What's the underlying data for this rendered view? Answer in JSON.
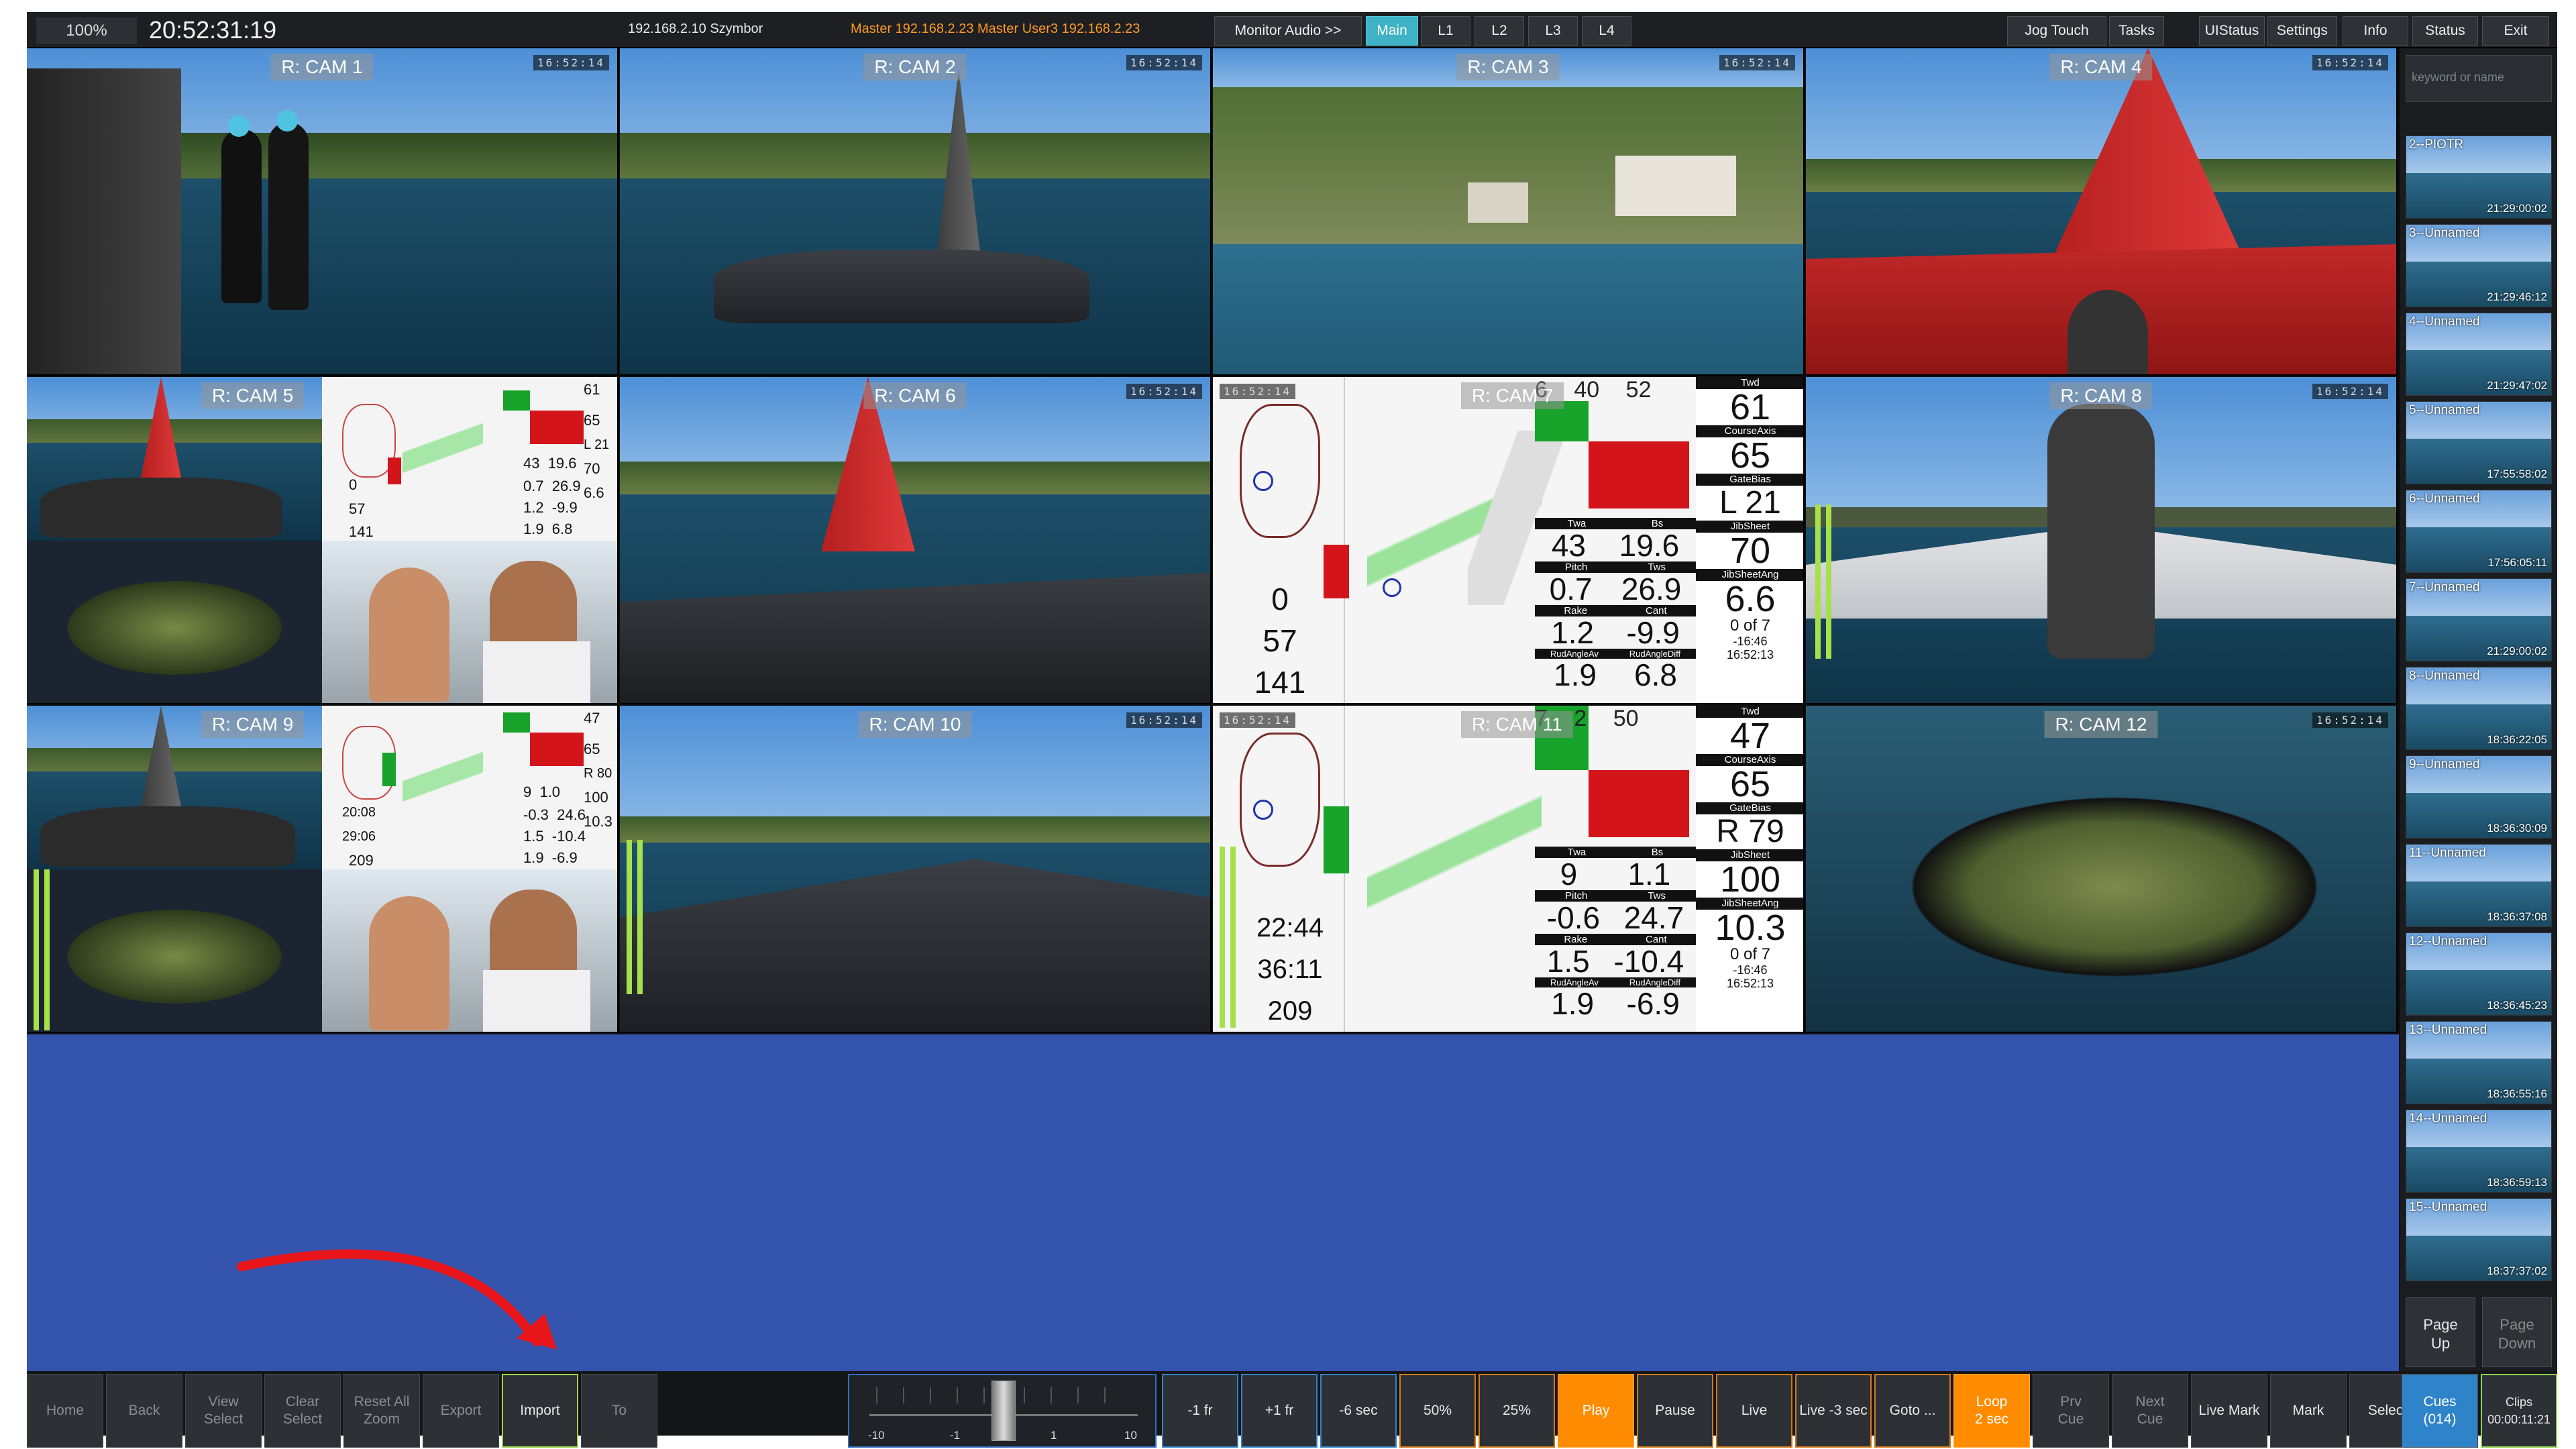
{
  "topbar": {
    "zoom": "100%",
    "clock": "20:52:31:19",
    "ip_user": "192.168.2.10 Szymbor",
    "master_info": "Master 192.168.2.23  Master  User3  192.168.2.23",
    "buttons": [
      "Monitor Audio >>",
      "Main",
      "L1",
      "L2",
      "L3",
      "L4"
    ],
    "right_buttons": [
      "Jog Touch",
      "Tasks",
      "UIStatus",
      "Settings",
      "Info",
      "Status",
      "Exit"
    ]
  },
  "cameras": [
    {
      "label": "R: CAM 1",
      "tc": "16:52:14"
    },
    {
      "label": "R: CAM 2",
      "tc": "16:52:14"
    },
    {
      "label": "R: CAM 3",
      "tc": "16:52:14"
    },
    {
      "label": "R: CAM 4",
      "tc": "16:52:14"
    },
    {
      "label": "R: CAM 5",
      "tc": "16:52:14"
    },
    {
      "label": "R: CAM 6",
      "tc": "16:52:14"
    },
    {
      "label": "R: CAM 7",
      "tc": "16:52:14"
    },
    {
      "label": "R: CAM 8",
      "tc": "16:52:14"
    },
    {
      "label": "R: CAM 9",
      "tc": "16:52:14"
    },
    {
      "label": "R: CAM 10",
      "tc": "16:52:14"
    },
    {
      "label": "R: CAM 11",
      "tc": "16:52:14"
    },
    {
      "label": "R: CAM 12",
      "tc": "16:52:14"
    }
  ],
  "telemetry_cam7": {
    "top": [
      "6",
      "40",
      "52",
      "61"
    ],
    "twd": "Twd",
    "course_axis": "CourseAxis",
    "course_val": "65",
    "gate_bias": "GateBias",
    "gate_val": "L 21",
    "twa": "43",
    "bs": "19.6",
    "twa_lbl": "Twa",
    "bs_lbl": "Bs",
    "jibsheet_lbl": "JibSheet",
    "jibsheet": "70",
    "pitch": "0.7",
    "tws": "26.9",
    "pitch_lbl": "Pitch",
    "tws_lbl": "Tws",
    "jibsheetang_lbl": "JibSheetAng",
    "jibsheetang": "6.6",
    "rake": "1.2",
    "cant": "-9.9",
    "rake_lbl": "Rake",
    "cant_lbl": "Cant",
    "zero_of": "0 of 7",
    "delta": "-16:46",
    "rud_av": "1.9",
    "rud_diff": "6.8",
    "rud_av_lbl": "RudAngleAv",
    "rud_diff_lbl": "RudAngleDiff",
    "clock": "16:52:13",
    "left_nums": [
      "0",
      "57",
      "141"
    ]
  },
  "telemetry_cam11": {
    "top": [
      "7",
      "2",
      "50",
      "47"
    ],
    "twd": "Twd",
    "course_axis": "CourseAxis",
    "course_val": "65",
    "gate_bias": "GateBias",
    "gate_val": "R 79",
    "twa": "9",
    "bs": "1.1",
    "twa_lbl": "Twa",
    "bs_lbl": "Bs",
    "jibsheet_lbl": "JibSheet",
    "jibsheet": "100",
    "pitch": "-0.6",
    "tws": "24.7",
    "pitch_lbl": "Pitch",
    "tws_lbl": "Tws",
    "jibsheetang_lbl": "JibSheetAng",
    "jibsheetang": "10.3",
    "rake": "1.5",
    "cant": "-10.4",
    "rake_lbl": "Rake",
    "cant_lbl": "Cant",
    "zero_of": "0 of 7",
    "delta": "-16:46",
    "rud_av": "1.9",
    "rud_diff": "-6.9",
    "rud_av_lbl": "RudAngleAv",
    "rud_diff_lbl": "RudAngleDiff",
    "clock": "16:52:13",
    "left_nums": [
      "22:44",
      "36:11",
      "209"
    ]
  },
  "rightpanel": {
    "search_placeholder": "keyword or name",
    "clips": [
      {
        "name": "2--PIOTR",
        "tc": "21:29:00:02"
      },
      {
        "name": "3--Unnamed",
        "tc": "21:29:46:12"
      },
      {
        "name": "4--Unnamed",
        "tc": "21:29:47:02"
      },
      {
        "name": "5--Unnamed",
        "tc": "17:55:58:02"
      },
      {
        "name": "6--Unnamed",
        "tc": "17:56:05:11"
      },
      {
        "name": "7--Unnamed",
        "tc": "21:29:00:02"
      },
      {
        "name": "8--Unnamed",
        "tc": "18:36:22:05"
      },
      {
        "name": "9--Unnamed",
        "tc": "18:36:30:09"
      },
      {
        "name": "11--Unnamed",
        "tc": "18:36:37:08"
      },
      {
        "name": "12--Unnamed",
        "tc": "18:36:45:23"
      },
      {
        "name": "13--Unnamed",
        "tc": "18:36:55:16"
      },
      {
        "name": "14--Unnamed",
        "tc": "18:36:59:13"
      },
      {
        "name": "15--Unnamed",
        "tc": "18:37:37:02"
      }
    ],
    "page_up": "Page\nUp",
    "page_down": "Page\nDown"
  },
  "bottombar": {
    "left_buttons": [
      "Home",
      "Back",
      "View\nSelect",
      "Clear\nSelect",
      "Reset All\nZoom",
      "Export",
      "Import",
      "To"
    ],
    "jog_labels": [
      "-10",
      "-1",
      "1",
      "10"
    ],
    "right_buttons": [
      "-1 fr",
      "+1 fr",
      "-6 sec",
      "50%",
      "25%",
      "Play",
      "Pause",
      "Live",
      "Live -3 sec",
      "Goto ...",
      "Loop\n2 sec",
      "Prv\nCue",
      "Next\nCue",
      "Live Mark",
      "Mark",
      "Select",
      "Cues\n(014)",
      "Clips\n00:00:11:21"
    ]
  },
  "colors": {
    "blue_area": "#3453ad",
    "accent_orange": "#ff8c00",
    "accent_cyan": "#3fb3c5",
    "annotation_arrow": "#e8161b"
  }
}
